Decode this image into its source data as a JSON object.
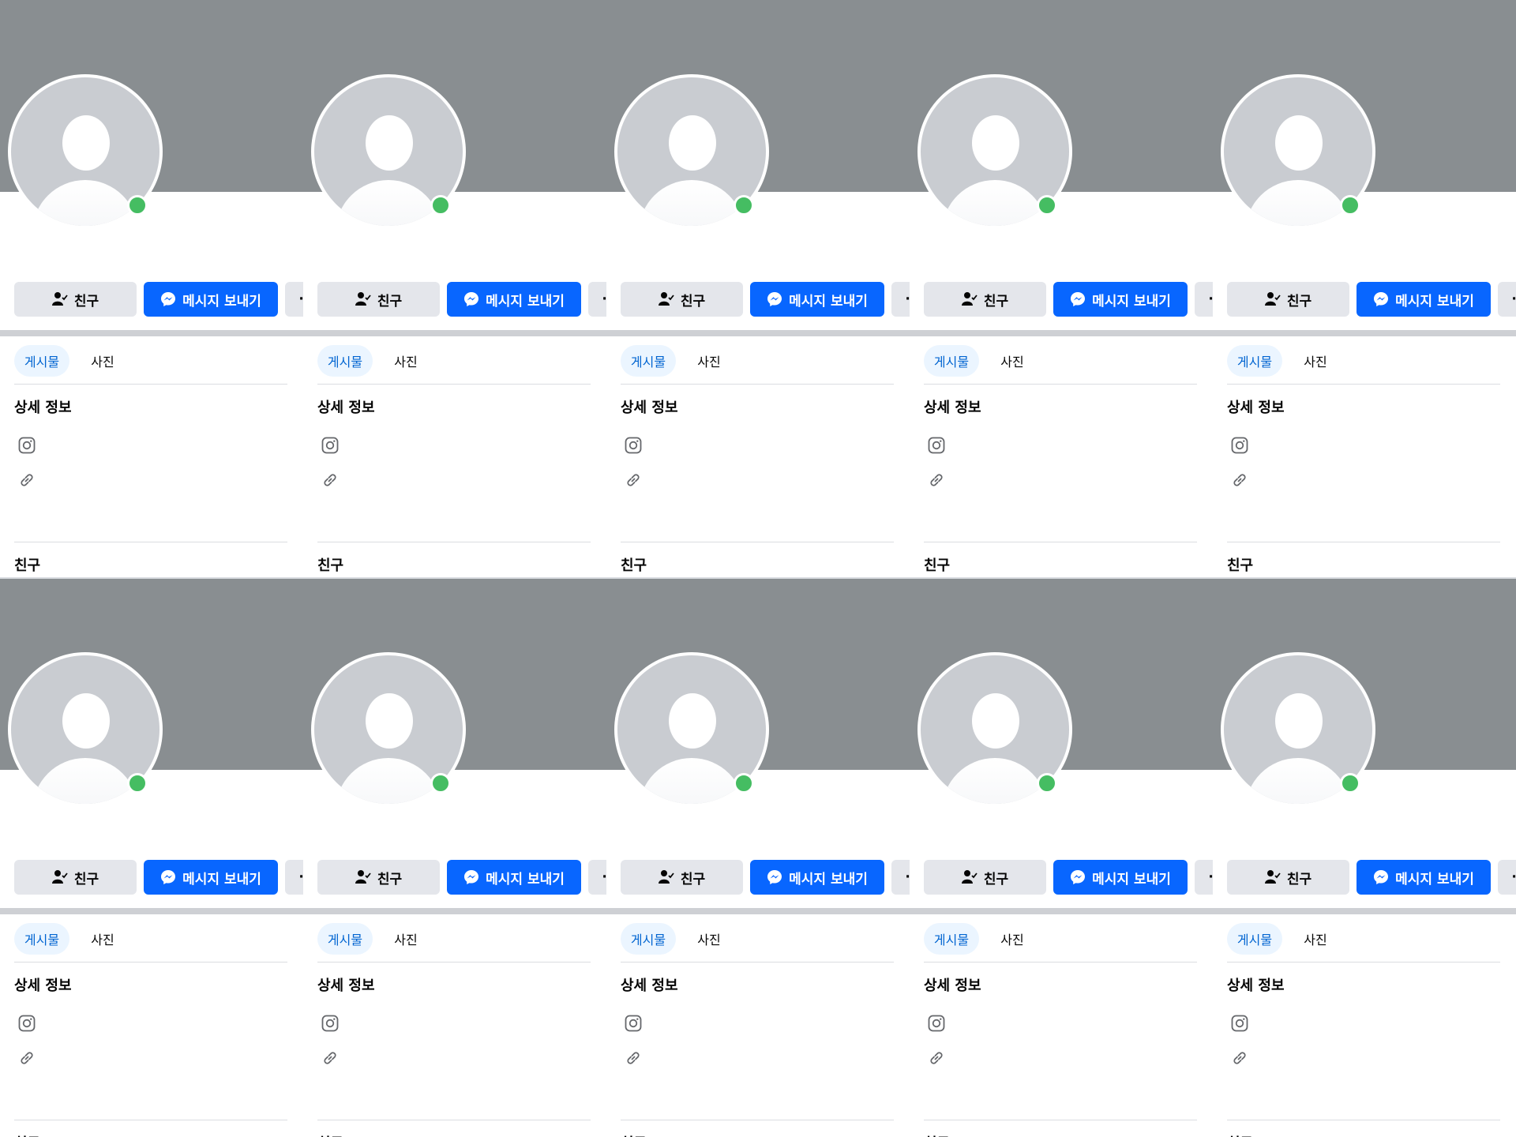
{
  "profile": {
    "friend_button_label": "친구",
    "message_button_label": "메시지 보내기",
    "more_button_label": "···",
    "tabs": [
      "게시물",
      "사진"
    ],
    "details_title": "상세 정보",
    "friends_title": "친구",
    "icons": {
      "friend": "friend-check-icon",
      "messenger": "messenger-icon",
      "instagram": "instagram-icon",
      "link": "link-icon",
      "more": "more-icon"
    },
    "colors": {
      "cover": "#898e91",
      "primary": "#0866ff",
      "online": "#45bd62",
      "tab_active_bg": "#ebf5ff",
      "tab_active_text": "#0064d1"
    }
  }
}
